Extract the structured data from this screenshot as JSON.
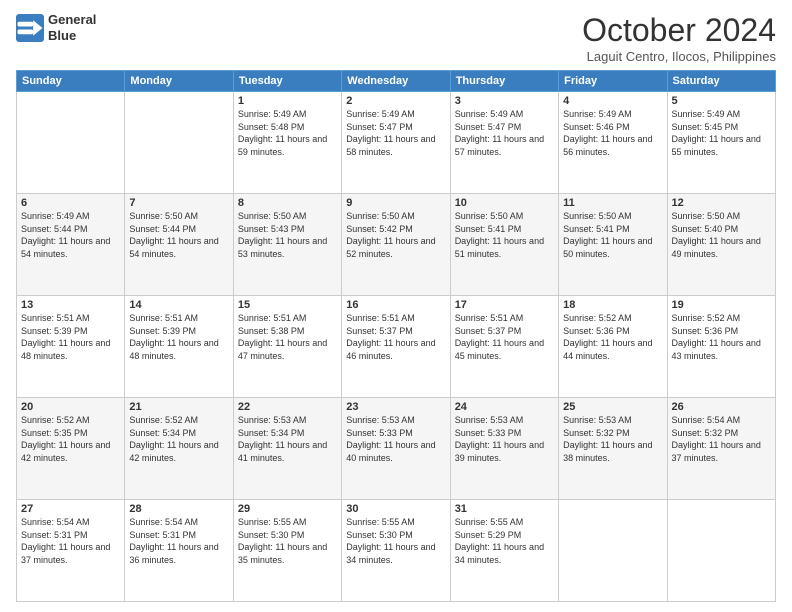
{
  "header": {
    "logo_line1": "General",
    "logo_line2": "Blue",
    "month": "October 2024",
    "location": "Laguit Centro, Ilocos, Philippines"
  },
  "weekdays": [
    "Sunday",
    "Monday",
    "Tuesday",
    "Wednesday",
    "Thursday",
    "Friday",
    "Saturday"
  ],
  "weeks": [
    [
      {
        "day": "",
        "sunrise": "",
        "sunset": "",
        "daylight": ""
      },
      {
        "day": "",
        "sunrise": "",
        "sunset": "",
        "daylight": ""
      },
      {
        "day": "1",
        "sunrise": "Sunrise: 5:49 AM",
        "sunset": "Sunset: 5:48 PM",
        "daylight": "Daylight: 11 hours and 59 minutes."
      },
      {
        "day": "2",
        "sunrise": "Sunrise: 5:49 AM",
        "sunset": "Sunset: 5:47 PM",
        "daylight": "Daylight: 11 hours and 58 minutes."
      },
      {
        "day": "3",
        "sunrise": "Sunrise: 5:49 AM",
        "sunset": "Sunset: 5:47 PM",
        "daylight": "Daylight: 11 hours and 57 minutes."
      },
      {
        "day": "4",
        "sunrise": "Sunrise: 5:49 AM",
        "sunset": "Sunset: 5:46 PM",
        "daylight": "Daylight: 11 hours and 56 minutes."
      },
      {
        "day": "5",
        "sunrise": "Sunrise: 5:49 AM",
        "sunset": "Sunset: 5:45 PM",
        "daylight": "Daylight: 11 hours and 55 minutes."
      }
    ],
    [
      {
        "day": "6",
        "sunrise": "Sunrise: 5:49 AM",
        "sunset": "Sunset: 5:44 PM",
        "daylight": "Daylight: 11 hours and 54 minutes."
      },
      {
        "day": "7",
        "sunrise": "Sunrise: 5:50 AM",
        "sunset": "Sunset: 5:44 PM",
        "daylight": "Daylight: 11 hours and 54 minutes."
      },
      {
        "day": "8",
        "sunrise": "Sunrise: 5:50 AM",
        "sunset": "Sunset: 5:43 PM",
        "daylight": "Daylight: 11 hours and 53 minutes."
      },
      {
        "day": "9",
        "sunrise": "Sunrise: 5:50 AM",
        "sunset": "Sunset: 5:42 PM",
        "daylight": "Daylight: 11 hours and 52 minutes."
      },
      {
        "day": "10",
        "sunrise": "Sunrise: 5:50 AM",
        "sunset": "Sunset: 5:41 PM",
        "daylight": "Daylight: 11 hours and 51 minutes."
      },
      {
        "day": "11",
        "sunrise": "Sunrise: 5:50 AM",
        "sunset": "Sunset: 5:41 PM",
        "daylight": "Daylight: 11 hours and 50 minutes."
      },
      {
        "day": "12",
        "sunrise": "Sunrise: 5:50 AM",
        "sunset": "Sunset: 5:40 PM",
        "daylight": "Daylight: 11 hours and 49 minutes."
      }
    ],
    [
      {
        "day": "13",
        "sunrise": "Sunrise: 5:51 AM",
        "sunset": "Sunset: 5:39 PM",
        "daylight": "Daylight: 11 hours and 48 minutes."
      },
      {
        "day": "14",
        "sunrise": "Sunrise: 5:51 AM",
        "sunset": "Sunset: 5:39 PM",
        "daylight": "Daylight: 11 hours and 48 minutes."
      },
      {
        "day": "15",
        "sunrise": "Sunrise: 5:51 AM",
        "sunset": "Sunset: 5:38 PM",
        "daylight": "Daylight: 11 hours and 47 minutes."
      },
      {
        "day": "16",
        "sunrise": "Sunrise: 5:51 AM",
        "sunset": "Sunset: 5:37 PM",
        "daylight": "Daylight: 11 hours and 46 minutes."
      },
      {
        "day": "17",
        "sunrise": "Sunrise: 5:51 AM",
        "sunset": "Sunset: 5:37 PM",
        "daylight": "Daylight: 11 hours and 45 minutes."
      },
      {
        "day": "18",
        "sunrise": "Sunrise: 5:52 AM",
        "sunset": "Sunset: 5:36 PM",
        "daylight": "Daylight: 11 hours and 44 minutes."
      },
      {
        "day": "19",
        "sunrise": "Sunrise: 5:52 AM",
        "sunset": "Sunset: 5:36 PM",
        "daylight": "Daylight: 11 hours and 43 minutes."
      }
    ],
    [
      {
        "day": "20",
        "sunrise": "Sunrise: 5:52 AM",
        "sunset": "Sunset: 5:35 PM",
        "daylight": "Daylight: 11 hours and 42 minutes."
      },
      {
        "day": "21",
        "sunrise": "Sunrise: 5:52 AM",
        "sunset": "Sunset: 5:34 PM",
        "daylight": "Daylight: 11 hours and 42 minutes."
      },
      {
        "day": "22",
        "sunrise": "Sunrise: 5:53 AM",
        "sunset": "Sunset: 5:34 PM",
        "daylight": "Daylight: 11 hours and 41 minutes."
      },
      {
        "day": "23",
        "sunrise": "Sunrise: 5:53 AM",
        "sunset": "Sunset: 5:33 PM",
        "daylight": "Daylight: 11 hours and 40 minutes."
      },
      {
        "day": "24",
        "sunrise": "Sunrise: 5:53 AM",
        "sunset": "Sunset: 5:33 PM",
        "daylight": "Daylight: 11 hours and 39 minutes."
      },
      {
        "day": "25",
        "sunrise": "Sunrise: 5:53 AM",
        "sunset": "Sunset: 5:32 PM",
        "daylight": "Daylight: 11 hours and 38 minutes."
      },
      {
        "day": "26",
        "sunrise": "Sunrise: 5:54 AM",
        "sunset": "Sunset: 5:32 PM",
        "daylight": "Daylight: 11 hours and 37 minutes."
      }
    ],
    [
      {
        "day": "27",
        "sunrise": "Sunrise: 5:54 AM",
        "sunset": "Sunset: 5:31 PM",
        "daylight": "Daylight: 11 hours and 37 minutes."
      },
      {
        "day": "28",
        "sunrise": "Sunrise: 5:54 AM",
        "sunset": "Sunset: 5:31 PM",
        "daylight": "Daylight: 11 hours and 36 minutes."
      },
      {
        "day": "29",
        "sunrise": "Sunrise: 5:55 AM",
        "sunset": "Sunset: 5:30 PM",
        "daylight": "Daylight: 11 hours and 35 minutes."
      },
      {
        "day": "30",
        "sunrise": "Sunrise: 5:55 AM",
        "sunset": "Sunset: 5:30 PM",
        "daylight": "Daylight: 11 hours and 34 minutes."
      },
      {
        "day": "31",
        "sunrise": "Sunrise: 5:55 AM",
        "sunset": "Sunset: 5:29 PM",
        "daylight": "Daylight: 11 hours and 34 minutes."
      },
      {
        "day": "",
        "sunrise": "",
        "sunset": "",
        "daylight": ""
      },
      {
        "day": "",
        "sunrise": "",
        "sunset": "",
        "daylight": ""
      }
    ]
  ]
}
